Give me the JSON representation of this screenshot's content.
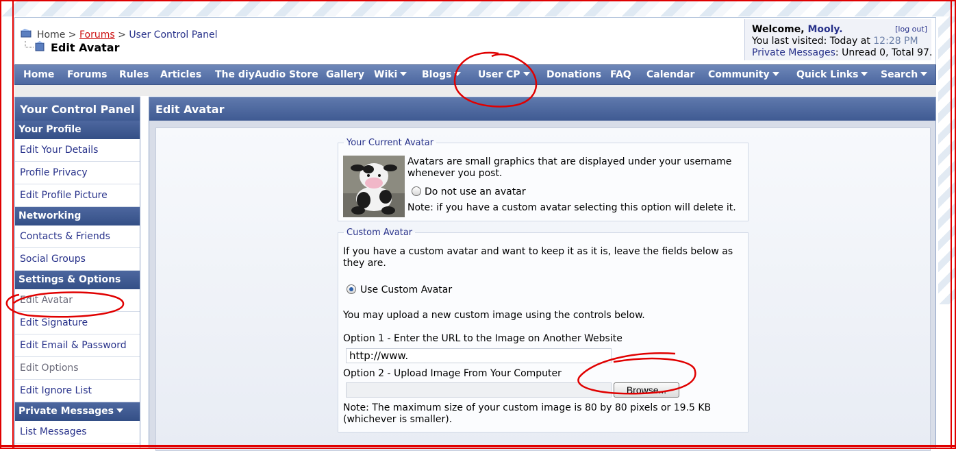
{
  "breadcrumb": {
    "home": "Home",
    "sep1": ">",
    "forums": "Forums",
    "sep2": ">",
    "ucp": "User Control Panel",
    "current": "Edit Avatar"
  },
  "welcome": {
    "prefix": "Welcome,",
    "username": "Mooly.",
    "logout": "[log out]",
    "last_visited_label": "You last visited: Today at",
    "last_visited_time": "12:28 PM",
    "pm_label": "Private Messages",
    "pm_counts": ": Unread 0, Total 97."
  },
  "nav": {
    "items": [
      "Home",
      "Forums",
      "Rules",
      "Articles",
      "The diyAudio Store",
      "Gallery",
      "Wiki",
      "Blogs",
      "User CP",
      "Donations",
      "FAQ",
      "Calendar",
      "Community",
      "Quick Links",
      "Search"
    ]
  },
  "sidebar": {
    "title": "Your Control Panel",
    "sections": [
      {
        "title": "Your Profile",
        "items": [
          "Edit Your Details",
          "Profile Privacy",
          "Edit Profile Picture"
        ]
      },
      {
        "title": "Networking",
        "items": [
          "Contacts & Friends",
          "Social Groups"
        ]
      },
      {
        "title": "Settings & Options",
        "items": [
          "Edit Avatar",
          "Edit Signature",
          "Edit Email & Password",
          "Edit Options",
          "Edit Ignore List"
        ]
      },
      {
        "title": "Private Messages",
        "items": [
          "List Messages"
        ]
      }
    ]
  },
  "main": {
    "title": "Edit Avatar",
    "current": {
      "legend": "Your Current Avatar",
      "desc1": "Avatars are small graphics that are displayed under your username",
      "desc2": "whenever you post.",
      "no_avatar": "Do not use an avatar",
      "note": "Note: if you have a custom avatar selecting this option will delete it."
    },
    "custom": {
      "legend": "Custom Avatar",
      "intro1": "If you have a custom avatar and want to keep it as it is, leave the fields below as",
      "intro2": "they are.",
      "use_custom": "Use Custom Avatar",
      "upload_hint": "You may upload a new custom image using the controls below.",
      "option1": "Option 1 - Enter the URL to the Image on Another Website",
      "url_value": "http://www.",
      "option2": "Option 2 - Upload Image From Your Computer",
      "browse": "Browse...",
      "note1": "Note: The maximum size of your custom image is 80 by 80 pixels or 19.5 KB",
      "note2": "(whichever is smaller)."
    }
  },
  "colors": {
    "accent_blue": "#4c67a0",
    "link_blue": "#27318a",
    "annotation_red": "#e00000"
  },
  "icons": [
    "home-icon",
    "sub-page-icon",
    "dropdown-caret-icon",
    "radio-icon"
  ]
}
